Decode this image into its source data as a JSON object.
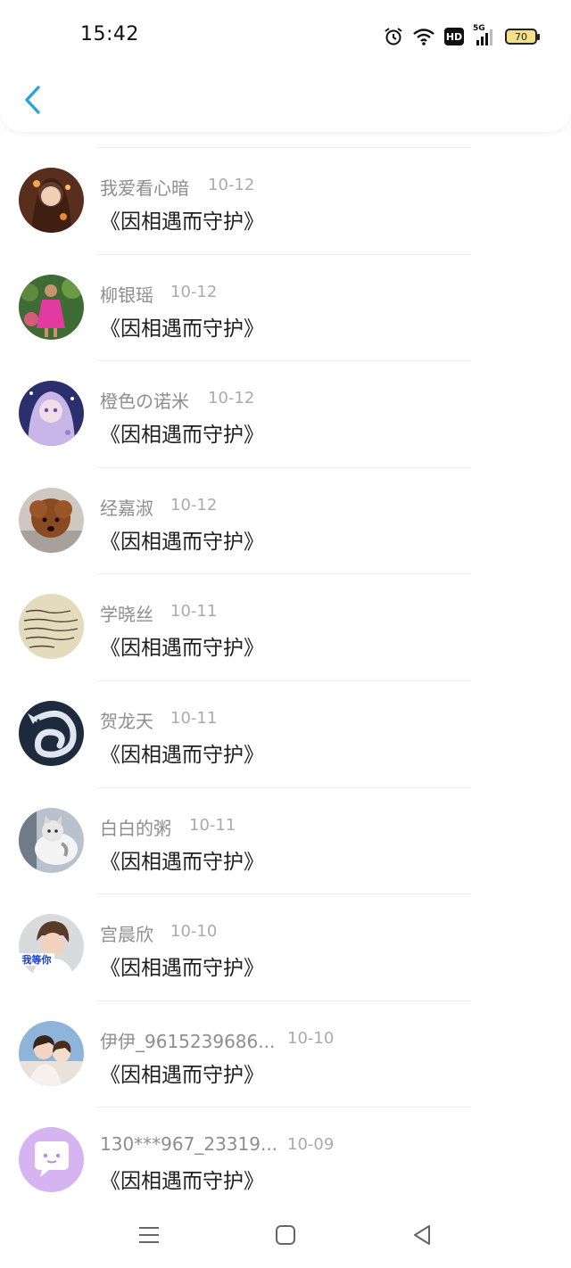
{
  "status_bar": {
    "time": "15:42",
    "network": "5G",
    "hd_label": "HD",
    "battery": "70"
  },
  "colors": {
    "accent": "#2aa0e6",
    "name_gray": "#8e8e8e",
    "date_gray": "#ababab",
    "battery_fill": "#f2e08a"
  },
  "header": {
    "back_icon": "chevron-left-icon"
  },
  "list": [
    {
      "name": "我爱看心暗",
      "date": "10-12",
      "text": "《因相遇而守护》",
      "avatar": "anime-girl-avatar"
    },
    {
      "name": "柳银瑶",
      "date": "10-12",
      "text": "《因相遇而守护》",
      "avatar": "girl-pink-dress-avatar"
    },
    {
      "name": "橙色の诺米",
      "date": "10-12",
      "text": "《因相遇而守护》",
      "avatar": "anime-purple-avatar"
    },
    {
      "name": "经嘉淑",
      "date": "10-12",
      "text": "《因相遇而守护》",
      "avatar": "poodle-avatar"
    },
    {
      "name": "学晓丝",
      "date": "10-11",
      "text": "《因相遇而守护》",
      "avatar": "handwriting-avatar"
    },
    {
      "name": "贺龙天",
      "date": "10-11",
      "text": "《因相遇而守护》",
      "avatar": "dragon-avatar"
    },
    {
      "name": "白白的粥",
      "date": "10-11",
      "text": "《因相遇而守护》",
      "avatar": "cat-avatar"
    },
    {
      "name": "宫晨欣",
      "date": "10-10",
      "text": "《因相遇而守护》",
      "avatar": "boy-photo-avatar",
      "avatar_caption": "我等你"
    },
    {
      "name": "伊伊_9615239686...",
      "date": "10-10",
      "text": "《因相遇而守护》",
      "avatar": "couple-photo-avatar"
    },
    {
      "name": "130***967_23319...",
      "date": "10-09",
      "text": "《因相遇而守护》",
      "avatar": "default-chat-avatar"
    }
  ],
  "nav_bar": {
    "menu_icon": "menu-icon",
    "home_icon": "home-square-icon",
    "back_icon": "back-triangle-icon"
  }
}
